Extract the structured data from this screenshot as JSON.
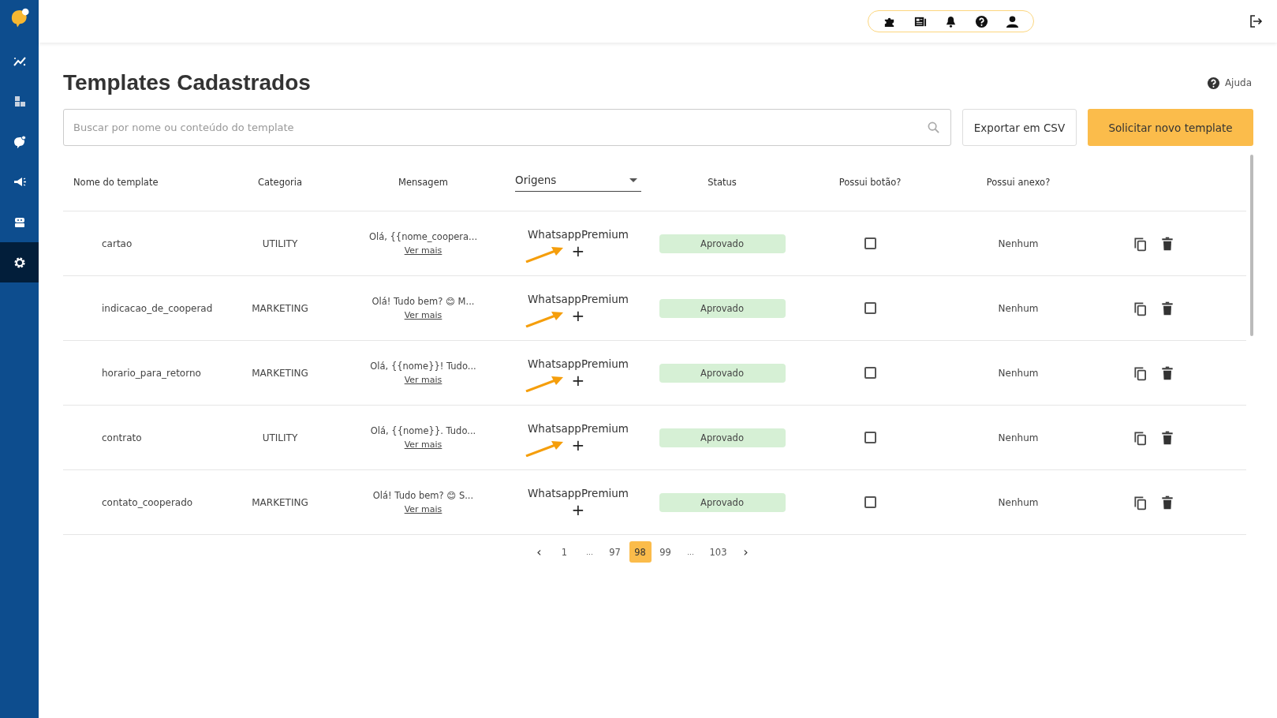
{
  "sidebar": {
    "items": [
      {
        "selected": false
      },
      {
        "selected": false
      },
      {
        "selected": false
      },
      {
        "selected": false
      },
      {
        "selected": false
      },
      {
        "selected": true
      }
    ]
  },
  "page": {
    "title": "Templates Cadastrados",
    "help_link": "Ajuda"
  },
  "search": {
    "placeholder": "Buscar por nome ou conteúdo do template"
  },
  "buttons": [
    {
      "label": "Exportar em CSV",
      "kind": "outline"
    },
    {
      "label": "Solicitar novo template",
      "kind": "primary"
    }
  ],
  "table": {
    "columns": [
      {
        "label": "Nome do template",
        "kind": "text"
      },
      {
        "label": "Categoria",
        "kind": "text"
      },
      {
        "label": "Mensagem",
        "kind": "text"
      },
      {
        "label": "Origens",
        "kind": "select"
      },
      {
        "label": "Status",
        "kind": "text"
      },
      {
        "label": "Possui botão?",
        "kind": "text"
      },
      {
        "label": "Possui anexo?",
        "kind": "text"
      }
    ],
    "rows": [
      {
        "name": "cartao",
        "category": "UTILITY",
        "message": "Olá, {{nome_coopera...",
        "more": "Ver mais",
        "origin": "WhatsappPremium",
        "add": "+",
        "status": "Aprovado",
        "has_button": false,
        "attachment": "Nenhum",
        "arrow": true
      },
      {
        "name": "indicacao_de_cooperad",
        "category": "MARKETING",
        "message": "Olá! Tudo bem? 😊 M...",
        "more": "Ver mais",
        "origin": "WhatsappPremium",
        "add": "+",
        "status": "Aprovado",
        "has_button": false,
        "attachment": "Nenhum",
        "arrow": true
      },
      {
        "name": "horario_para_retorno",
        "category": "MARKETING",
        "message": "Olá, {{nome}}! Tudo...",
        "more": "Ver mais",
        "origin": "WhatsappPremium",
        "add": "+",
        "status": "Aprovado",
        "has_button": false,
        "attachment": "Nenhum",
        "arrow": true
      },
      {
        "name": "contrato",
        "category": "UTILITY",
        "message": "Olá, {{nome}}. Tudo...",
        "more": "Ver mais",
        "origin": "WhatsappPremium",
        "add": "+",
        "status": "Aprovado",
        "has_button": false,
        "attachment": "Nenhum",
        "arrow": true
      },
      {
        "name": "contato_cooperado",
        "category": "MARKETING",
        "message": "Olá! Tudo bem? 😊 S...",
        "more": "Ver mais",
        "origin": "WhatsappPremium",
        "add": "+",
        "status": "Aprovado",
        "has_button": false,
        "attachment": "Nenhum",
        "arrow": false
      }
    ]
  },
  "pagination": {
    "prev": "‹",
    "next": "›",
    "pages": [
      {
        "label": "1",
        "kind": "page",
        "selected": false
      },
      {
        "label": "...",
        "kind": "gap",
        "selected": false
      },
      {
        "label": "97",
        "kind": "page",
        "selected": false
      },
      {
        "label": "98",
        "kind": "page",
        "selected": true
      },
      {
        "label": "99",
        "kind": "page",
        "selected": false
      },
      {
        "label": "...",
        "kind": "gap",
        "selected": false
      },
      {
        "label": "103",
        "kind": "page",
        "selected": false
      }
    ]
  }
}
